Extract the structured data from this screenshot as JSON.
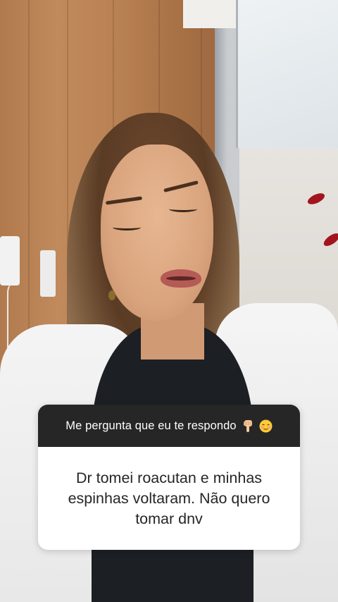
{
  "question_sticker": {
    "prompt": "Me pergunta que eu te respondo",
    "emojis": [
      "backhand-index-pointing-down-icon",
      "smiling-blush-face-icon"
    ],
    "answer": "Dr tomei roacutan e minhas espinhas voltaram. Não quero tomar dnv",
    "header_color": "#262626",
    "body_color": "#ffffff"
  }
}
